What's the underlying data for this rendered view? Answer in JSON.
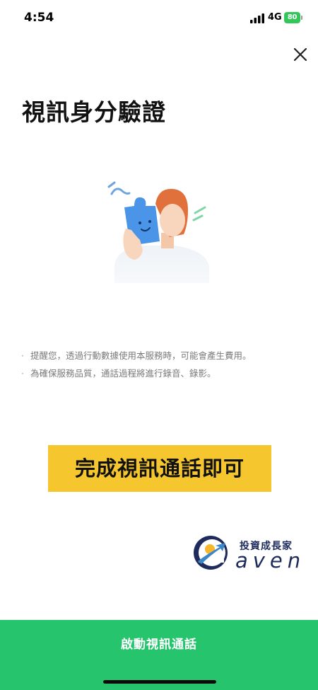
{
  "status_bar": {
    "time": "4:54",
    "network": "4G",
    "battery": "80"
  },
  "page": {
    "title": "視訊身分驗證"
  },
  "notices": [
    "提醒您，透過行動數據使用本服務時，可能會產生費用。",
    "為確保服務品質，通話過程將進行錄音、錄影。"
  ],
  "notice_bullet": "·",
  "banner": {
    "text": "完成視訊通話即可"
  },
  "brand": {
    "name": "投資成長家",
    "wordmark": "aven"
  },
  "actions": {
    "start_call_label": "啟動視訊通話"
  },
  "colors": {
    "primary_green": "#27c46e",
    "banner_yellow": "#f6c62f",
    "battery_green": "#32c759",
    "brand_navy": "#1e2b5c"
  },
  "icons": {
    "close": "close-icon",
    "signal": "cellular-signal-icon",
    "battery": "battery-icon"
  }
}
